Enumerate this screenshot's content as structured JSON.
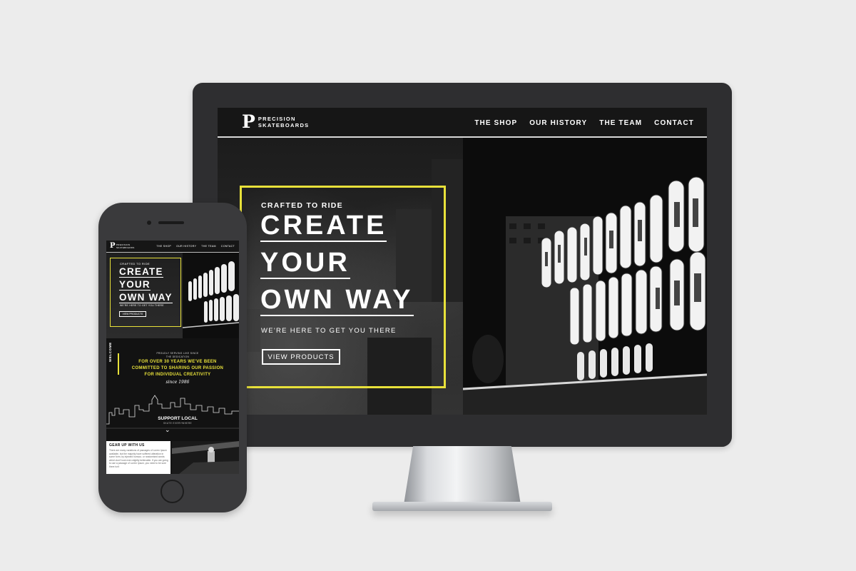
{
  "desktop": {
    "logo_mark": "P",
    "logo_line1": "PRECISION",
    "logo_line2": "SKATEBOARDS",
    "nav": [
      "THE SHOP",
      "OUR HISTORY",
      "THE TEAM",
      "CONTACT"
    ],
    "hero": {
      "kicker": "CRAFTED TO RIDE",
      "headline": [
        "CREATE",
        "YOUR",
        "OWN WAY"
      ],
      "subtitle": "WE'RE HERE TO GET YOU THERE",
      "button": "VIEW PRODUCTS"
    }
  },
  "mobile": {
    "logo_mark": "P",
    "logo_line1": "PRECISION",
    "logo_line2": "SKATEBOARDS",
    "nav": [
      "THE SHOP",
      "OUR HISTORY",
      "THE TEAM",
      "CONTACT"
    ],
    "hero": {
      "kicker": "CRAFTED TO RIDE",
      "headline": [
        "CREATE",
        "YOUR",
        "OWN WAY"
      ],
      "subtitle": "WE'RE HERE TO GET YOU THERE",
      "button": "VIEW PRODUCTS"
    },
    "welcome": {
      "side_label": "WELCOME",
      "proudly": "PROUDLY SERVING LIKE SINCE",
      "dedication": "THE DEDICATION",
      "lines": [
        "FOR OVER 30 YEARS WE'VE BEEN",
        "COMMITTED TO SHARING OUR PASSION",
        "FOR INDIVIDUAL CREATIVITY"
      ],
      "since": "since 1986",
      "support": "SUPPORT LOCAL",
      "skate": "SKATE EVERYWHERE"
    },
    "gear": {
      "title": "GEAR UP WITH US",
      "body": "There are many variations of passages of Lorem Ipsum available, but the majority have suffered alteration in some form, by injected humour, or randomised words which don't look even slightly believable. If you are going to use a passage of Lorem Ipsum, you need to be sure there isn't"
    }
  },
  "colors": {
    "accent": "#e8e13a",
    "screen_bg": "#111111",
    "page_bg": "#ececec"
  },
  "icons": [
    "chevron-down-icon",
    "logo-p-icon",
    "home-button-icon"
  ]
}
